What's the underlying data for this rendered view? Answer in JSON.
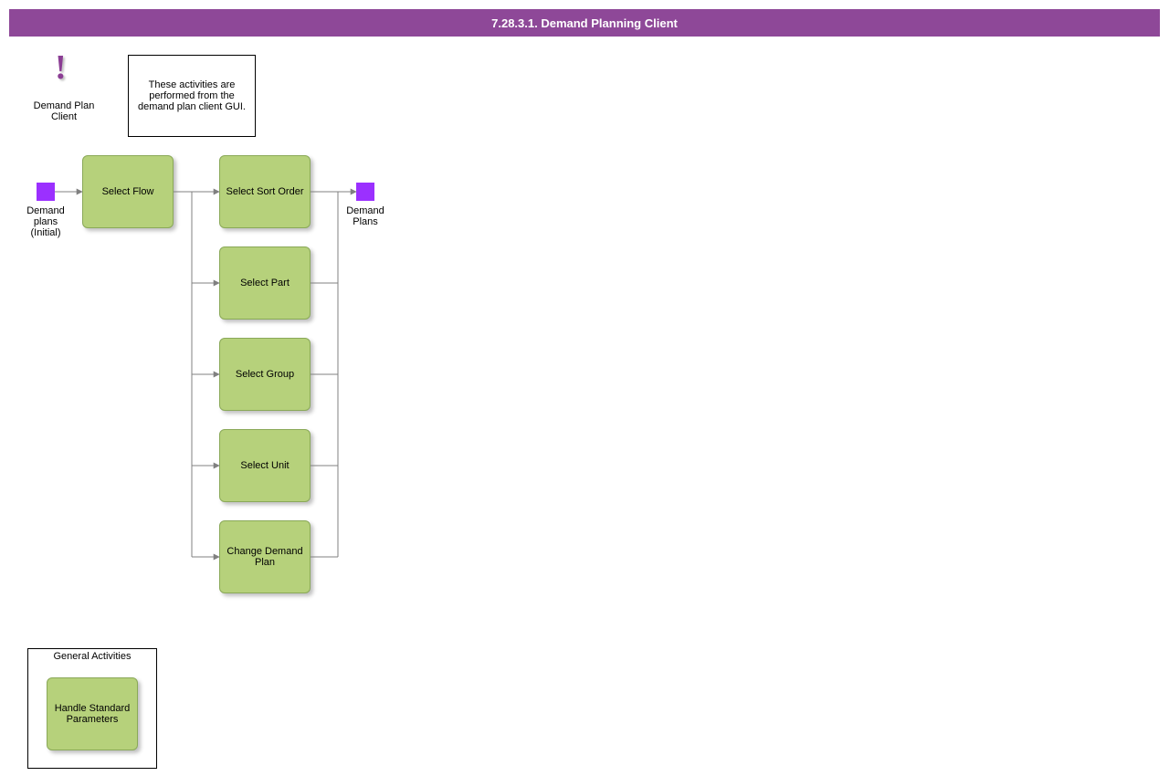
{
  "title": "7.28.3.1. Demand Planning Client",
  "exclaim_label": "Demand Plan Client",
  "note": "These activities are performed from the demand plan client GUI.",
  "start_marker_label": "Demand plans (Initial)",
  "end_marker_label": "Demand Plans",
  "nodes": {
    "flow": "Select Flow",
    "sort": "Select Sort Order",
    "part": "Select Part",
    "group": "Select Group",
    "unit": "Select Unit",
    "change": "Change Demand Plan"
  },
  "general_title": "General Activities",
  "general_node": "Handle Standard Parameters",
  "colors": {
    "titlebar": "#8e4898",
    "node": "#b6d17b",
    "marker": "#9b30ff"
  }
}
